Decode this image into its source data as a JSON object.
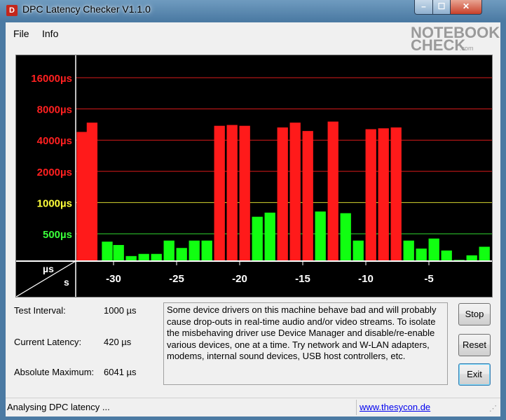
{
  "window": {
    "title": "DPC Latency Checker V1.1.0",
    "controls": {
      "minimize": "–",
      "maximize": "☐",
      "close": "✕"
    }
  },
  "menu": {
    "file": "File",
    "info": "Info"
  },
  "watermark": {
    "line1": "NOTEBOOK",
    "line2": "CHECK",
    "suffix": ".com"
  },
  "chart_data": {
    "type": "bar",
    "y_scale": "log",
    "y_ticks": [
      {
        "label": "16000µs",
        "value": 16000,
        "color": "#ff2020"
      },
      {
        "label": "8000µs",
        "value": 8000,
        "color": "#ff2020"
      },
      {
        "label": "4000µs",
        "value": 4000,
        "color": "#ff2020"
      },
      {
        "label": "2000µs",
        "value": 2000,
        "color": "#ff2020"
      },
      {
        "label": "1000µs",
        "value": 1000,
        "color": "#ffff3a"
      },
      {
        "label": "500µs",
        "value": 500,
        "color": "#3aff3a"
      }
    ],
    "ylabel": "µs",
    "xlabel": "s",
    "x_ticks": [
      "-30",
      "-25",
      "-20",
      "-15",
      "-10",
      "-5"
    ],
    "x_tick_values": [
      -30,
      -25,
      -20,
      -15,
      -10,
      -5
    ],
    "x_range": [
      -33,
      0
    ],
    "red_threshold": 1000,
    "bar_colors": {
      "high": "#ff1a1a",
      "low": "#11ff11"
    },
    "bar_width": 0.85,
    "x": [
      -32.5,
      -31.7,
      -30.5,
      -29.6,
      -28.6,
      -27.6,
      -26.6,
      -25.6,
      -24.6,
      -23.6,
      -22.6,
      -21.6,
      -20.6,
      -19.6,
      -18.6,
      -17.6,
      -16.6,
      -15.6,
      -14.6,
      -13.6,
      -12.6,
      -11.6,
      -10.6,
      -9.6,
      -8.6,
      -7.6,
      -6.6,
      -5.6,
      -4.6,
      -3.6,
      -2.6,
      -1.6,
      -0.6
    ],
    "values": [
      4800,
      5900,
      420,
      390,
      305,
      320,
      320,
      430,
      365,
      430,
      430,
      5500,
      5600,
      5500,
      730,
      800,
      5300,
      5900,
      4900,
      820,
      6041,
      790,
      430,
      5100,
      5200,
      5300,
      430,
      360,
      450,
      345,
      280,
      310,
      375
    ]
  },
  "stats": {
    "test_interval_label": "Test Interval:",
    "test_interval_value": "1000 µs",
    "current_latency_label": "Current Latency:",
    "current_latency_value": "420 µs",
    "absolute_max_label": "Absolute Maximum:",
    "absolute_max_value": "6041 µs"
  },
  "message": "Some device drivers on this machine behave bad and will probably cause drop-outs in real-time audio and/or video streams. To isolate the misbehaving driver use Device Manager and disable/re-enable various devices, one at a time. Try network and W-LAN adapters, modems, internal sound devices, USB host controllers, etc.",
  "buttons": {
    "stop": "Stop",
    "reset": "Reset",
    "exit": "Exit"
  },
  "status": {
    "text": "Analysing DPC latency ...",
    "link": "www.thesycon.de"
  }
}
